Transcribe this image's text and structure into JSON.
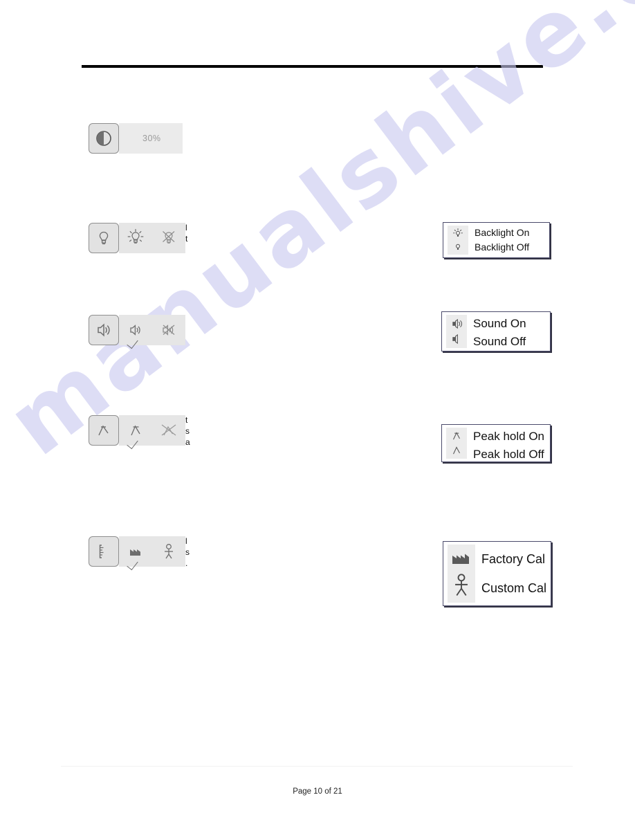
{
  "document": {
    "footer_text": "Page 10 of 21",
    "watermark_text": "manualshive.com",
    "watermark_color": "#c9c9ef",
    "rule_color": "#000000"
  },
  "rows": [
    {
      "id": "brightness",
      "button_icon": "contrast-icon",
      "value": "30%",
      "tray_items": []
    },
    {
      "id": "backlight",
      "button_icon": "lightbulb-icon",
      "tray_items": [
        {
          "icon": "lightbulb-on-icon",
          "checked": false
        },
        {
          "icon": "lightbulb-off-icon",
          "checked": false
        }
      ],
      "fragment_lines": [
        "l",
        "t"
      ]
    },
    {
      "id": "sound",
      "button_icon": "speaker-icon",
      "tray_items": [
        {
          "icon": "sound-on-icon",
          "checked": true
        },
        {
          "icon": "sound-muted-icon",
          "checked": false
        }
      ],
      "fragment_lines": []
    },
    {
      "id": "peak-hold",
      "button_icon": "peak-hold-icon",
      "tray_items": [
        {
          "icon": "peak-hold-on-icon",
          "checked": true
        },
        {
          "icon": "peak-hold-off-icon",
          "checked": false
        }
      ],
      "fragment_lines": [
        "t",
        "s",
        "a"
      ]
    },
    {
      "id": "calibration",
      "button_icon": "calibration-scale-icon",
      "tray_items": [
        {
          "icon": "factory-icon",
          "checked": true
        },
        {
          "icon": "person-icon",
          "checked": false
        }
      ],
      "fragment_lines": [
        "l",
        "s",
        "."
      ]
    }
  ],
  "callouts": [
    {
      "id": "backlight",
      "size": "sm",
      "items": [
        {
          "icon": "lightbulb-on-icon",
          "label": "Backlight On"
        },
        {
          "icon": "lightbulb-off-icon",
          "label": "Backlight Off"
        }
      ]
    },
    {
      "id": "sound",
      "size": "md",
      "items": [
        {
          "icon": "sound-on-icon",
          "label": "Sound On"
        },
        {
          "icon": "sound-off-icon",
          "label": "Sound Off"
        }
      ]
    },
    {
      "id": "peak-hold",
      "size": "md",
      "items": [
        {
          "icon": "peak-hold-on-icon",
          "label": "Peak hold On"
        },
        {
          "icon": "peak-hold-off-icon",
          "label": "Peak hold Off"
        }
      ]
    },
    {
      "id": "calibration",
      "size": "lg",
      "items": [
        {
          "icon": "factory-icon",
          "label": "Factory Cal"
        },
        {
          "icon": "person-icon",
          "label": "Custom Cal"
        }
      ]
    }
  ]
}
